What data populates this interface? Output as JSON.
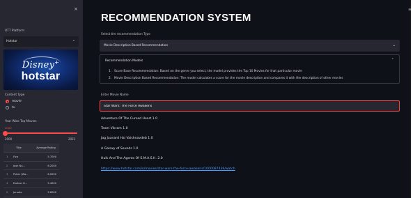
{
  "sidebar": {
    "close_symbol": "×",
    "ott_label": "OTT Platform",
    "ott_selected": "Hotstar",
    "ott_chevron": "⌄",
    "banner": {
      "brand_top": "Disney",
      "brand_plus": "+",
      "brand_bottom": "hotstar"
    },
    "content_label": "Content Type",
    "content_options": [
      {
        "label": "movie",
        "selected": true
      },
      {
        "label": "tv",
        "selected": false
      }
    ],
    "slider_label": "Year Wise Top Movies",
    "slider_value": "2000",
    "slider_min": "2000",
    "slider_max": "2021",
    "slider_fraction": 0.0,
    "table": {
      "columns": [
        "Title",
        "Average Rating"
      ],
      "rows": [
        {
          "index": "1",
          "title": "Fiza",
          "rating": "5.7000"
        },
        {
          "index": "2",
          "title": "Josh Nu...",
          "rating": "6.2000"
        },
        {
          "index": "3",
          "title": "Pukar (Wa...",
          "rating": "6.0000"
        },
        {
          "index": "4",
          "title": "Dulhan H...",
          "rating": "5.4000"
        },
        {
          "index": "5",
          "title": "Joradia",
          "rating": "5.6000"
        }
      ]
    }
  },
  "main": {
    "title": "RECOMMENDATION SYSTEM",
    "menu_symbol": "≡",
    "rec_type_label": "Select the recommendation Type",
    "rec_type_selected": "Movie Description Based Recommendation",
    "rec_type_chevron": "⌄",
    "expander": {
      "title": "Recommendation Models",
      "caret": "⌃",
      "items": [
        "Score Base Recommendation: Based on the genre you select, the model provides the Top 10 Movies for that particular movie",
        "Movie Description Based Recommendation: The model calculates a score for the movie description and compares it with the description of other movies"
      ]
    },
    "movie_name_label": "Enter Movie Name",
    "movie_name_value": "Star Wars: The Force Awakens",
    "results": [
      "Adventure Of The Cursed Heart 1.0",
      "Team Vikram 1.0",
      "Jag Jaanard Hai Vaishnavdeb 1.0",
      "A Galaxy of Sounds 1.0",
      "Hulk And The Agents Of S.M.A.S.H. 2.0"
    ],
    "link_text": "https://www.hotstar.com/in/movies/star-wars-the-force-awakens/1000087439/watch"
  },
  "colors": {
    "accent": "#ff4b4b",
    "background": "#0e1117",
    "sidebar": "#262730",
    "link": "#4a9bff"
  }
}
